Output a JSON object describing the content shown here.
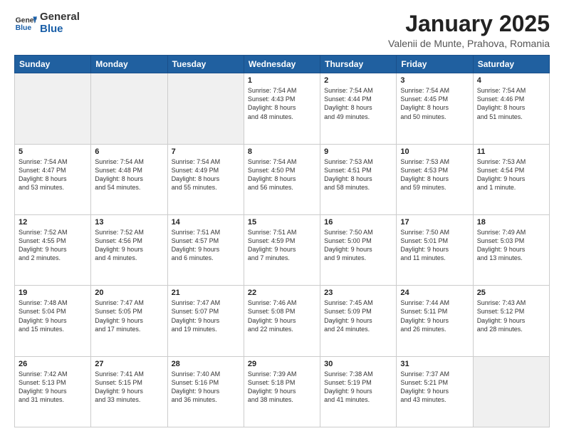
{
  "logo": {
    "line1": "General",
    "line2": "Blue"
  },
  "title": "January 2025",
  "subtitle": "Valenii de Munte, Prahova, Romania",
  "header": {
    "days": [
      "Sunday",
      "Monday",
      "Tuesday",
      "Wednesday",
      "Thursday",
      "Friday",
      "Saturday"
    ]
  },
  "weeks": [
    [
      {
        "day": "",
        "info": ""
      },
      {
        "day": "",
        "info": ""
      },
      {
        "day": "",
        "info": ""
      },
      {
        "day": "1",
        "info": "Sunrise: 7:54 AM\nSunset: 4:43 PM\nDaylight: 8 hours\nand 48 minutes."
      },
      {
        "day": "2",
        "info": "Sunrise: 7:54 AM\nSunset: 4:44 PM\nDaylight: 8 hours\nand 49 minutes."
      },
      {
        "day": "3",
        "info": "Sunrise: 7:54 AM\nSunset: 4:45 PM\nDaylight: 8 hours\nand 50 minutes."
      },
      {
        "day": "4",
        "info": "Sunrise: 7:54 AM\nSunset: 4:46 PM\nDaylight: 8 hours\nand 51 minutes."
      }
    ],
    [
      {
        "day": "5",
        "info": "Sunrise: 7:54 AM\nSunset: 4:47 PM\nDaylight: 8 hours\nand 53 minutes."
      },
      {
        "day": "6",
        "info": "Sunrise: 7:54 AM\nSunset: 4:48 PM\nDaylight: 8 hours\nand 54 minutes."
      },
      {
        "day": "7",
        "info": "Sunrise: 7:54 AM\nSunset: 4:49 PM\nDaylight: 8 hours\nand 55 minutes."
      },
      {
        "day": "8",
        "info": "Sunrise: 7:54 AM\nSunset: 4:50 PM\nDaylight: 8 hours\nand 56 minutes."
      },
      {
        "day": "9",
        "info": "Sunrise: 7:53 AM\nSunset: 4:51 PM\nDaylight: 8 hours\nand 58 minutes."
      },
      {
        "day": "10",
        "info": "Sunrise: 7:53 AM\nSunset: 4:53 PM\nDaylight: 8 hours\nand 59 minutes."
      },
      {
        "day": "11",
        "info": "Sunrise: 7:53 AM\nSunset: 4:54 PM\nDaylight: 9 hours\nand 1 minute."
      }
    ],
    [
      {
        "day": "12",
        "info": "Sunrise: 7:52 AM\nSunset: 4:55 PM\nDaylight: 9 hours\nand 2 minutes."
      },
      {
        "day": "13",
        "info": "Sunrise: 7:52 AM\nSunset: 4:56 PM\nDaylight: 9 hours\nand 4 minutes."
      },
      {
        "day": "14",
        "info": "Sunrise: 7:51 AM\nSunset: 4:57 PM\nDaylight: 9 hours\nand 6 minutes."
      },
      {
        "day": "15",
        "info": "Sunrise: 7:51 AM\nSunset: 4:59 PM\nDaylight: 9 hours\nand 7 minutes."
      },
      {
        "day": "16",
        "info": "Sunrise: 7:50 AM\nSunset: 5:00 PM\nDaylight: 9 hours\nand 9 minutes."
      },
      {
        "day": "17",
        "info": "Sunrise: 7:50 AM\nSunset: 5:01 PM\nDaylight: 9 hours\nand 11 minutes."
      },
      {
        "day": "18",
        "info": "Sunrise: 7:49 AM\nSunset: 5:03 PM\nDaylight: 9 hours\nand 13 minutes."
      }
    ],
    [
      {
        "day": "19",
        "info": "Sunrise: 7:48 AM\nSunset: 5:04 PM\nDaylight: 9 hours\nand 15 minutes."
      },
      {
        "day": "20",
        "info": "Sunrise: 7:47 AM\nSunset: 5:05 PM\nDaylight: 9 hours\nand 17 minutes."
      },
      {
        "day": "21",
        "info": "Sunrise: 7:47 AM\nSunset: 5:07 PM\nDaylight: 9 hours\nand 19 minutes."
      },
      {
        "day": "22",
        "info": "Sunrise: 7:46 AM\nSunset: 5:08 PM\nDaylight: 9 hours\nand 22 minutes."
      },
      {
        "day": "23",
        "info": "Sunrise: 7:45 AM\nSunset: 5:09 PM\nDaylight: 9 hours\nand 24 minutes."
      },
      {
        "day": "24",
        "info": "Sunrise: 7:44 AM\nSunset: 5:11 PM\nDaylight: 9 hours\nand 26 minutes."
      },
      {
        "day": "25",
        "info": "Sunrise: 7:43 AM\nSunset: 5:12 PM\nDaylight: 9 hours\nand 28 minutes."
      }
    ],
    [
      {
        "day": "26",
        "info": "Sunrise: 7:42 AM\nSunset: 5:13 PM\nDaylight: 9 hours\nand 31 minutes."
      },
      {
        "day": "27",
        "info": "Sunrise: 7:41 AM\nSunset: 5:15 PM\nDaylight: 9 hours\nand 33 minutes."
      },
      {
        "day": "28",
        "info": "Sunrise: 7:40 AM\nSunset: 5:16 PM\nDaylight: 9 hours\nand 36 minutes."
      },
      {
        "day": "29",
        "info": "Sunrise: 7:39 AM\nSunset: 5:18 PM\nDaylight: 9 hours\nand 38 minutes."
      },
      {
        "day": "30",
        "info": "Sunrise: 7:38 AM\nSunset: 5:19 PM\nDaylight: 9 hours\nand 41 minutes."
      },
      {
        "day": "31",
        "info": "Sunrise: 7:37 AM\nSunset: 5:21 PM\nDaylight: 9 hours\nand 43 minutes."
      },
      {
        "day": "",
        "info": ""
      }
    ]
  ]
}
